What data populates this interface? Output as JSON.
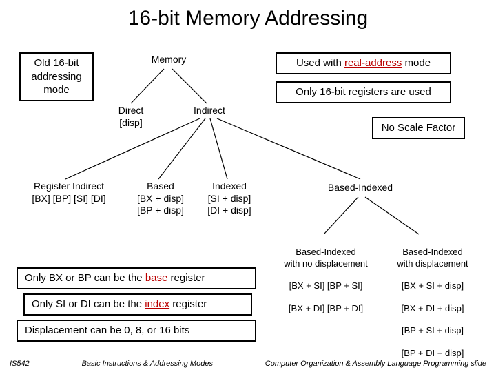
{
  "title": "16-bit Memory Addressing",
  "boxes": {
    "old_mode": "Old 16-bit\naddressing\nmode",
    "used_with_pre": "Used with ",
    "used_with_red": "real-address",
    "used_with_post": " mode",
    "only16": "Only 16-bit registers are used",
    "no_scale": "No Scale Factor",
    "base_pre": "Only BX or BP can be the ",
    "base_red": "base",
    "base_post": " register",
    "index_pre": "Only SI or DI can be the ",
    "index_red": "index",
    "index_post": " register",
    "disp": "Displacement can be 0, 8, or 16 bits"
  },
  "tree": {
    "root": "Memory",
    "direct": {
      "label": "Direct",
      "expr": "[disp]"
    },
    "indirect": "Indirect",
    "reg_indirect": {
      "label": "Register Indirect",
      "expr": "[BX]  [BP]  [SI]  [DI]"
    },
    "based": {
      "label": "Based",
      "exprs": [
        "[BX + disp]",
        "[BP + disp]"
      ]
    },
    "indexed": {
      "label": "Indexed",
      "exprs": [
        "[SI + disp]",
        "[DI + disp]"
      ]
    },
    "based_indexed": "Based-Indexed",
    "bi_nodisp": {
      "label": "Based-Indexed\nwith no displacement",
      "exprs": [
        "[BX + SI]   [BP + SI]",
        "[BX + DI]   [BP + DI]"
      ]
    },
    "bi_disp": {
      "label": "Based-Indexed\nwith displacement",
      "exprs": [
        "[BX + SI + disp]",
        "[BX + DI + disp]",
        "[BP + SI + disp]",
        "[BP + DI + disp]"
      ]
    }
  },
  "footer": {
    "left": "IS542",
    "center": "Basic Instructions & Addressing Modes",
    "right": "Computer Organization & Assembly Language Programming slide"
  }
}
